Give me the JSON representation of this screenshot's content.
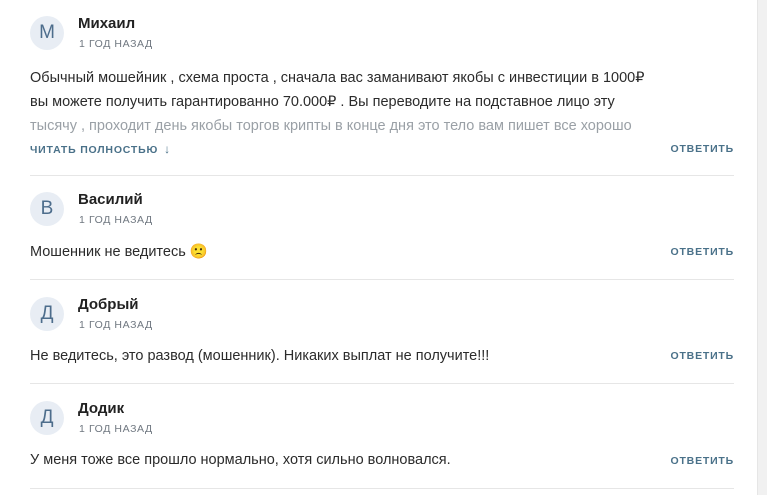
{
  "comments": [
    {
      "initial": "М",
      "author": "Михаил",
      "time": "1 год назад",
      "lines": [
        "Обычный мошейник , схема проста , сначала вас заманивают якобы с инвестиции в 1000₽",
        "вы можете получить гарантированно 70.000₽ . Вы переводите на подставное лицо эту",
        "тысячу , проходит день якобы торгов крипты в конце дня это тело вам пишет все хорошо"
      ],
      "read_more": "Читать полностью",
      "reply": "Ответить"
    },
    {
      "initial": "В",
      "author": "Василий",
      "time": "1 год назад",
      "text": "Мошенник не ведитесь 🙁",
      "reply": "Ответить"
    },
    {
      "initial": "Д",
      "author": "Добрый",
      "time": "1 год назад",
      "text": "Не ведитесь, это развод (мошенник). Никаких выплат не получите!!!",
      "reply": "Ответить"
    },
    {
      "initial": "Д",
      "author": "Додик",
      "time": "1 год назад",
      "text": "У меня тоже все прошло нормально, хотя сильно волновался.",
      "reply": "Ответить"
    }
  ],
  "icons": {
    "read_more": "arrow-down-icon"
  },
  "colors": {
    "accent": "#4a7189",
    "avatar_bg": "#e8edf4",
    "avatar_fg": "#4d6d8c",
    "divider": "#e6e6e6"
  }
}
